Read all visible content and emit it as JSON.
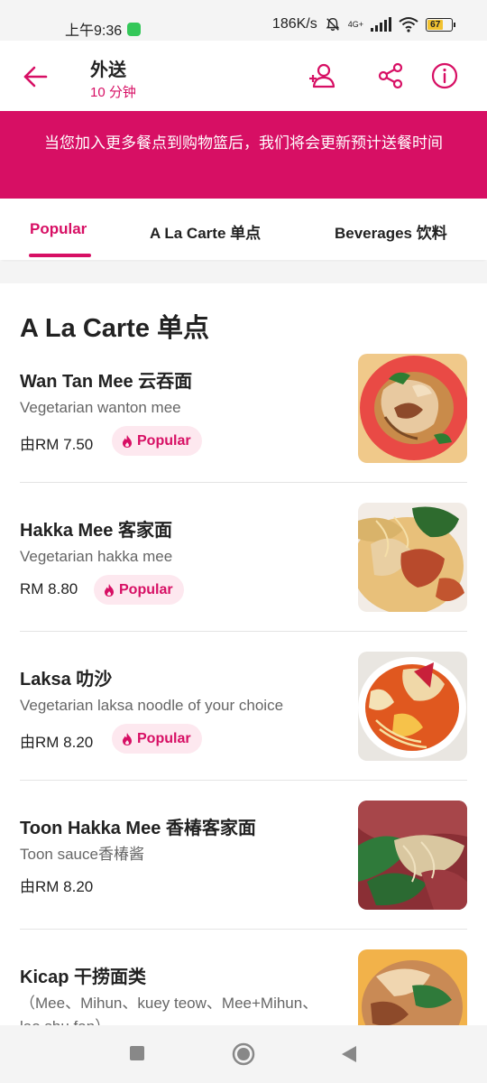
{
  "status_bar": {
    "time": "上午9:36",
    "speed": "186K/s",
    "network": "4G+",
    "battery": "67"
  },
  "header": {
    "title": "外送",
    "subtitle": "10 分钟"
  },
  "banner": {
    "text": "当您加入更多餐点到购物篮后，我们将会更新预计送餐时间"
  },
  "tabs": [
    {
      "label": "Popular",
      "active": true
    },
    {
      "label": "A La Carte 单点",
      "active": false
    },
    {
      "label": "Beverages 饮料",
      "active": false
    }
  ],
  "section": {
    "title": "A La Carte 单点"
  },
  "items": [
    {
      "name": "Wan Tan Mee 云吞面",
      "description": "Vegetarian wanton mee",
      "price": "由RM 7.50",
      "badge": "Popular"
    },
    {
      "name": "Hakka Mee 客家面",
      "description": "Vegetarian hakka mee",
      "price": "RM 8.80",
      "badge": "Popular"
    },
    {
      "name": "Laksa 叻沙",
      "description": "Vegetarian laksa noodle of your choice",
      "price": "由RM 8.20",
      "badge": "Popular"
    },
    {
      "name": "Toon Hakka Mee 香椿客家面",
      "description": "Toon sauce香椿酱",
      "price": "由RM 8.20",
      "badge": ""
    },
    {
      "name": "Kicap  干捞面类",
      "description": "（Mee、Mihun、kuey teow、Mee+Mihun、lao shu fan）",
      "price": "",
      "badge": ""
    }
  ],
  "colors": {
    "brand": "#d70f64",
    "badge_bg": "#fde8ef"
  },
  "icons": {
    "back": "arrow-left-icon",
    "group_order": "add-person-icon",
    "share": "share-icon",
    "info": "info-icon",
    "badge": "flame-icon"
  }
}
